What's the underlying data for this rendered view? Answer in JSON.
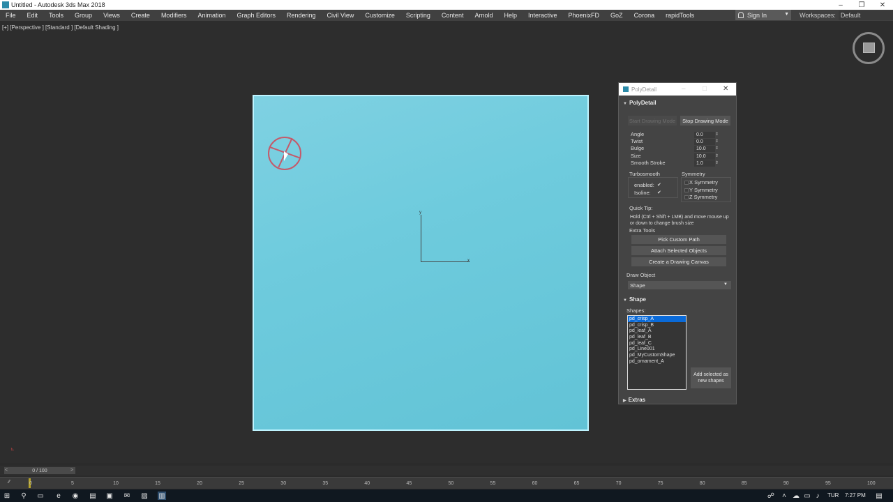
{
  "titlebar": {
    "title": "Untitled - Autodesk 3ds Max 2018",
    "minimize": "–",
    "restore": "❐",
    "close": "✕"
  },
  "menu": [
    "File",
    "Edit",
    "Tools",
    "Group",
    "Views",
    "Create",
    "Modifiers",
    "Animation",
    "Graph Editors",
    "Rendering",
    "Civil View",
    "Customize",
    "Scripting",
    "Content",
    "Arnold",
    "Help",
    "Interactive",
    "PhoenixFD",
    "GoZ",
    "Corona",
    "rapidTools"
  ],
  "signin": {
    "label": "Sign In",
    "arrow": "▼"
  },
  "workspaces": {
    "label": "Workspaces:",
    "value": "Default"
  },
  "viewport": {
    "label": "[+] [Perspective ] [Standard ] [Default Shading ]",
    "axis_y": "y",
    "axis_x": "x"
  },
  "panel": {
    "title": "PolyDetail",
    "close": "✕",
    "minimize": "–",
    "maximize": "□",
    "polydetail_head": "PolyDetail",
    "start_button": "Start Drawing Mode",
    "stop_button": "Stop Drawing Mode",
    "params": [
      {
        "label": "Angle",
        "value": "0.0"
      },
      {
        "label": "Twist",
        "value": "0.0"
      },
      {
        "label": "Bulge",
        "value": "10.0"
      },
      {
        "label": "Size",
        "value": "10.0"
      },
      {
        "label": "Smooth Stroke",
        "value": "1.0"
      }
    ],
    "turbosmooth": {
      "label": "Turbosmooth",
      "enabled": "enabled:",
      "isoline": "Isoline:",
      "check": "✔"
    },
    "symmetry": {
      "label": "Symmetry",
      "x": "X Symmetry",
      "y": "Y Symmetry",
      "z": "Z Symmetry"
    },
    "quick_tip": {
      "label": "Quick Tip:",
      "text": "Hold (Ctrl + Shift + LMB) and move mouse up or down to change brush size"
    },
    "extra_tools": {
      "label": "Extra Tools",
      "pick": "Pick Custom Path",
      "attach": "Attach Selected Objects",
      "canvas": "Create a Drawing Canvas"
    },
    "draw_object": {
      "label": "Draw Object",
      "value": "Shape",
      "arrow": "▼"
    },
    "shape_head": "Shape",
    "shapes_label": "Shapes:",
    "shapes": [
      "pd_crisp_A",
      "pd_crisp_B",
      "pd_leaf_A",
      "pd_leaf_B",
      "pd_leaf_C",
      "pd_Line001",
      "pd_MyCustomShape",
      "pd_ornament_A"
    ],
    "add_button": "Add selected as new shapes",
    "extras_head": "Extras",
    "rollout_tri": "▼",
    "rollout_tri_closed": "▶"
  },
  "timeline": {
    "slider_value": "0 / 100",
    "left_arrow": "<",
    "right_arrow": ">",
    "ticks": [
      "0",
      "5",
      "10",
      "15",
      "20",
      "25",
      "30",
      "35",
      "40",
      "45",
      "50",
      "55",
      "60",
      "65",
      "70",
      "75",
      "80",
      "85",
      "90",
      "95",
      "100"
    ]
  },
  "taskbar": {
    "language": "TUR",
    "time": "7:27 PM"
  }
}
